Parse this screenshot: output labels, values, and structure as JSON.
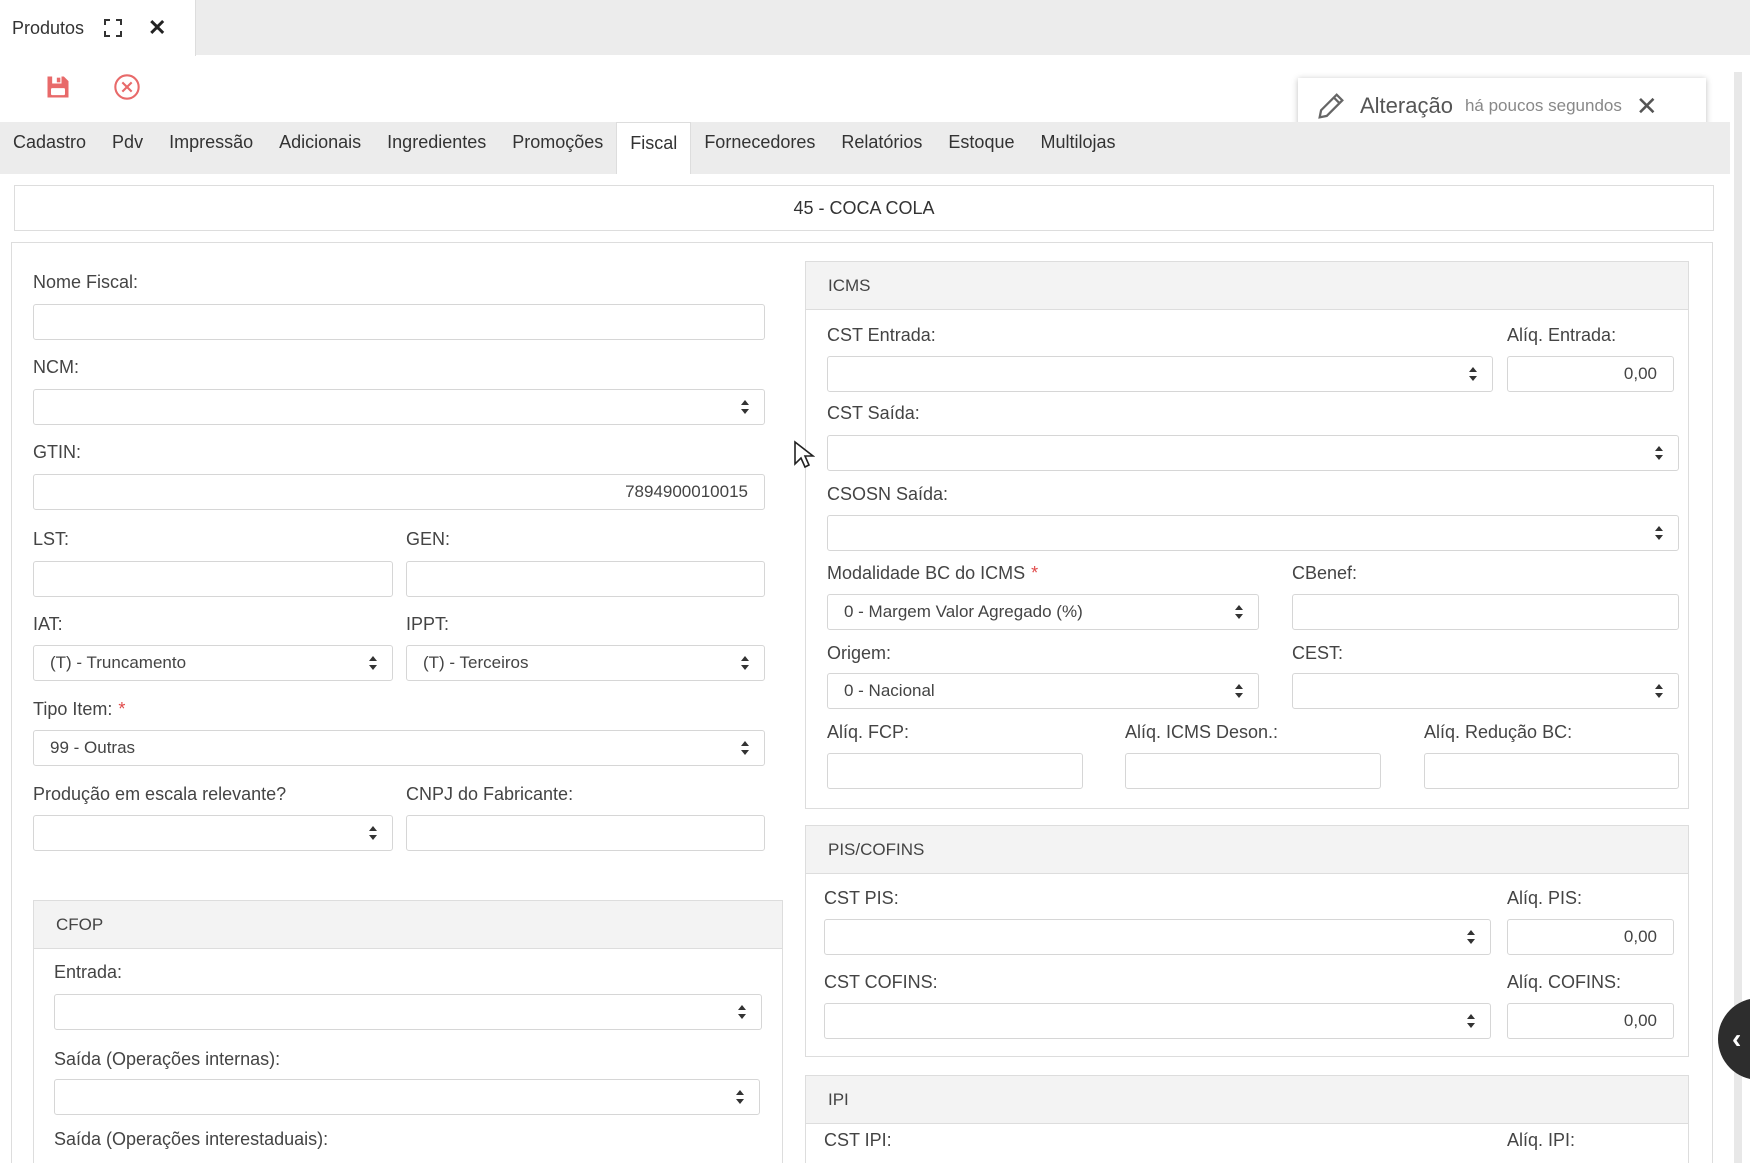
{
  "window": {
    "tab_title": "Produtos"
  },
  "toast": {
    "title": "Alteração",
    "time": "há poucos segundos",
    "close": "✕"
  },
  "tabs": [
    {
      "label": "Cadastro"
    },
    {
      "label": "Pdv"
    },
    {
      "label": "Impressão"
    },
    {
      "label": "Adicionais"
    },
    {
      "label": "Ingredientes"
    },
    {
      "label": "Promoções"
    },
    {
      "label": "Fiscal",
      "active": true
    },
    {
      "label": "Fornecedores"
    },
    {
      "label": "Relatórios"
    },
    {
      "label": "Estoque"
    },
    {
      "label": "Multilojas"
    }
  ],
  "product": {
    "header": "45 - COCA COLA"
  },
  "left": {
    "nome_fiscal": {
      "label": "Nome Fiscal:",
      "value": ""
    },
    "ncm": {
      "label": "NCM:",
      "value": ""
    },
    "gtin": {
      "label": "GTIN:",
      "value": "7894900010015"
    },
    "lst": {
      "label": "LST:",
      "value": ""
    },
    "gen": {
      "label": "GEN:",
      "value": ""
    },
    "iat": {
      "label": "IAT:",
      "value": "(T) - Truncamento"
    },
    "ippt": {
      "label": "IPPT:",
      "value": "(T) - Terceiros"
    },
    "tipo_item": {
      "label": "Tipo Item:",
      "required": "*",
      "value": "99 - Outras"
    },
    "producao": {
      "label": "Produção em escala relevante?",
      "value": ""
    },
    "cnpj": {
      "label": "CNPJ do Fabricante:",
      "value": ""
    }
  },
  "cfop": {
    "title": "CFOP",
    "entrada": {
      "label": "Entrada:",
      "value": ""
    },
    "saida_internas": {
      "label": "Saída (Operações internas):",
      "value": ""
    },
    "saida_interestaduais": {
      "label": "Saída (Operações interestaduais):"
    }
  },
  "icms": {
    "title": "ICMS",
    "cst_entrada": {
      "label": "CST Entrada:",
      "value": ""
    },
    "aliq_entrada": {
      "label": "Alíq. Entrada:",
      "value": "0,00"
    },
    "cst_saida": {
      "label": "CST Saída:",
      "value": ""
    },
    "csosn_saida": {
      "label": "CSOSN Saída:",
      "value": ""
    },
    "modalidade": {
      "label": "Modalidade BC do ICMS",
      "required": "*",
      "value": "0 - Margem Valor Agregado (%)"
    },
    "cbenef": {
      "label": "CBenef:",
      "value": ""
    },
    "origem": {
      "label": "Origem:",
      "value": "0 - Nacional"
    },
    "cest": {
      "label": "CEST:",
      "value": ""
    },
    "aliq_fcp": {
      "label": "Alíq. FCP:",
      "value": ""
    },
    "aliq_icms_deson": {
      "label": "Alíq. ICMS Deson.:",
      "value": ""
    },
    "aliq_reducao": {
      "label": "Alíq. Redução BC:",
      "value": ""
    }
  },
  "pis": {
    "title": "PIS/COFINS",
    "cst_pis": {
      "label": "CST PIS:",
      "value": ""
    },
    "aliq_pis": {
      "label": "Alíq. PIS:",
      "value": "0,00"
    },
    "cst_cofins": {
      "label": "CST COFINS:",
      "value": ""
    },
    "aliq_cofins": {
      "label": "Alíq. COFINS:",
      "value": "0,00"
    }
  },
  "ipi": {
    "title": "IPI",
    "cst_ipi": {
      "label": "CST IPI:"
    },
    "aliq_ipi": {
      "label": "Alíq. IPI:"
    }
  },
  "colors": {
    "save": "#e86a6a",
    "cancel": "#e86a6a",
    "required": "#e04848"
  }
}
